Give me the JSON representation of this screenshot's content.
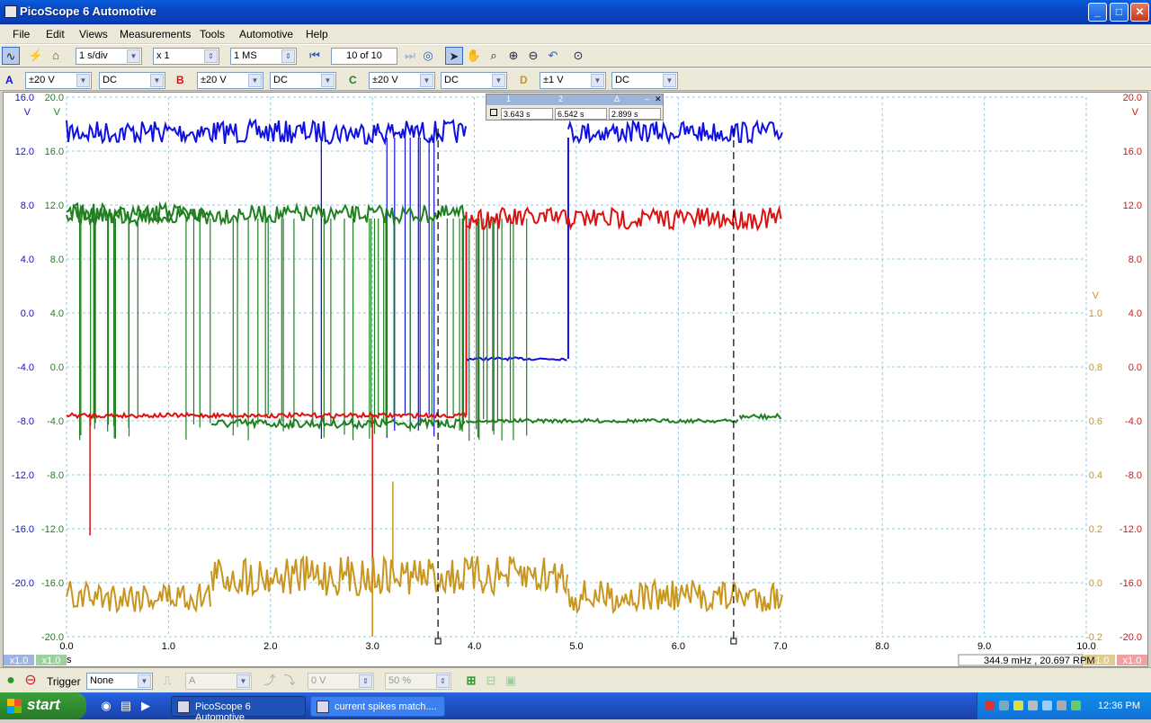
{
  "window": {
    "title": "PicoScope 6 Automotive",
    "minimize": "_",
    "maximize": "□",
    "close": "✕"
  },
  "menu": [
    "File",
    "Edit",
    "Views",
    "Measurements",
    "Tools",
    "Automotive",
    "Help"
  ],
  "toolbar": {
    "timebase": "1 s/div",
    "zoom": "x 1",
    "samples": "1 MS",
    "buffer": "10 of 10"
  },
  "channels": [
    {
      "label": "A",
      "range": "±20 V",
      "coupling": "DC",
      "color": "#1010e0"
    },
    {
      "label": "B",
      "range": "±20 V",
      "coupling": "DC",
      "color": "#e01010"
    },
    {
      "label": "C",
      "range": "±20 V",
      "coupling": "DC",
      "color": "#208020"
    },
    {
      "label": "D",
      "range": "±1 V",
      "coupling": "DC",
      "color": "#c8961e"
    }
  ],
  "rulers": {
    "headers": [
      "1",
      "2",
      "Δ"
    ],
    "values": [
      "3.643 s",
      "6.542 s",
      "2.899 s"
    ]
  },
  "chart_data": {
    "type": "line",
    "xlabel": "s",
    "xlim": [
      0,
      10
    ],
    "x_ticks": [
      "0.0",
      "1.0",
      "2.0",
      "3.0",
      "4.0",
      "5.0",
      "6.0",
      "7.0",
      "8.0",
      "9.0",
      "10.0"
    ],
    "axes": [
      {
        "channel": "A",
        "unit": "V",
        "ticks": [
          "16.0",
          "12.0",
          "8.0",
          "4.0",
          "0.0",
          "-4.0",
          "-8.0",
          "-12.0",
          "-16.0",
          "-20.0"
        ]
      },
      {
        "channel": "C",
        "unit": "V",
        "ticks": [
          "20.0",
          "16.0",
          "12.0",
          "8.0",
          "4.0",
          "0.0",
          "-4.0",
          "-8.0",
          "-12.0",
          "-16.0",
          "-20.0"
        ]
      },
      {
        "channel": "D",
        "unit": "V",
        "ticks": [
          "1.0",
          "0.8",
          "0.6",
          "0.4",
          "0.2",
          "0.0",
          "-0.2"
        ]
      },
      {
        "channel": "B",
        "unit": "V",
        "ticks": [
          "20.0",
          "16.0",
          "12.0",
          "8.0",
          "4.0",
          "0.0",
          "-4.0",
          "-8.0",
          "-12.0",
          "-16.0",
          "-20.0"
        ]
      }
    ],
    "ruler_times": [
      3.643,
      6.542
    ],
    "scale_badges": [
      "x1.0",
      "x1.0",
      "x1.0",
      "x1.0"
    ],
    "frequency_readout": "344.9 mHz , 20.697 RPM"
  },
  "status": {
    "trigger_label": "Trigger",
    "trigger_mode": "None",
    "trigger_source": "A",
    "threshold": "0 V",
    "pretrigger": "50 %"
  },
  "taskbar": {
    "start": "start",
    "tasks": [
      "PicoScope 6 Automotive",
      "current spikes match...."
    ],
    "clock": "12:36 PM"
  }
}
